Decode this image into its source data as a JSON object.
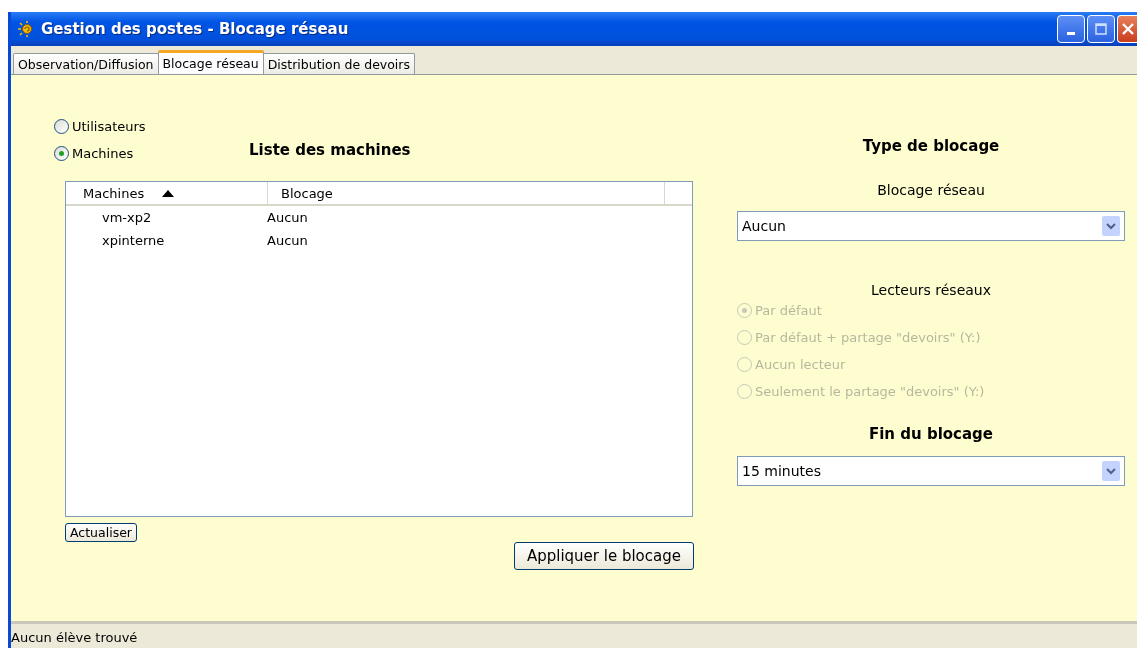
{
  "window": {
    "title": "Gestion des postes - Blocage réseau"
  },
  "tabs": [
    {
      "label": "Observation/Diffusion",
      "selected": false
    },
    {
      "label": "Blocage réseau",
      "selected": true
    },
    {
      "label": "Distribution de devoirs",
      "selected": false
    }
  ],
  "mode_options": [
    {
      "label": "Utilisateurs",
      "selected": false
    },
    {
      "label": "Machines",
      "selected": true
    }
  ],
  "list_title": "Liste des machines",
  "table": {
    "columns": [
      {
        "label": "Machines",
        "sorted": true
      },
      {
        "label": "Blocage",
        "sorted": false
      }
    ],
    "rows": [
      [
        "vm-xp2",
        "Aucun"
      ],
      [
        "xpinterne",
        "Aucun"
      ]
    ]
  },
  "refresh_button": "Actualiser",
  "apply_button": "Appliquer le blocage",
  "block_type_title": "Type de blocage",
  "network_block": {
    "label": "Blocage réseau",
    "value": "Aucun"
  },
  "drives": {
    "label": "Lecteurs réseaux",
    "options": [
      {
        "label": "Par défaut",
        "selected": true,
        "disabled": true
      },
      {
        "label": "Par défaut + partage \"devoirs\" (Y:)",
        "selected": false,
        "disabled": true
      },
      {
        "label": "Aucun lecteur",
        "selected": false,
        "disabled": true
      },
      {
        "label": "Seulement le partage \"devoirs\" (Y:)",
        "selected": false,
        "disabled": true
      }
    ]
  },
  "end_title": "Fin du blocage",
  "end_select": {
    "value": "15 minutes"
  },
  "status_bar": "Aucun élève trouvé"
}
